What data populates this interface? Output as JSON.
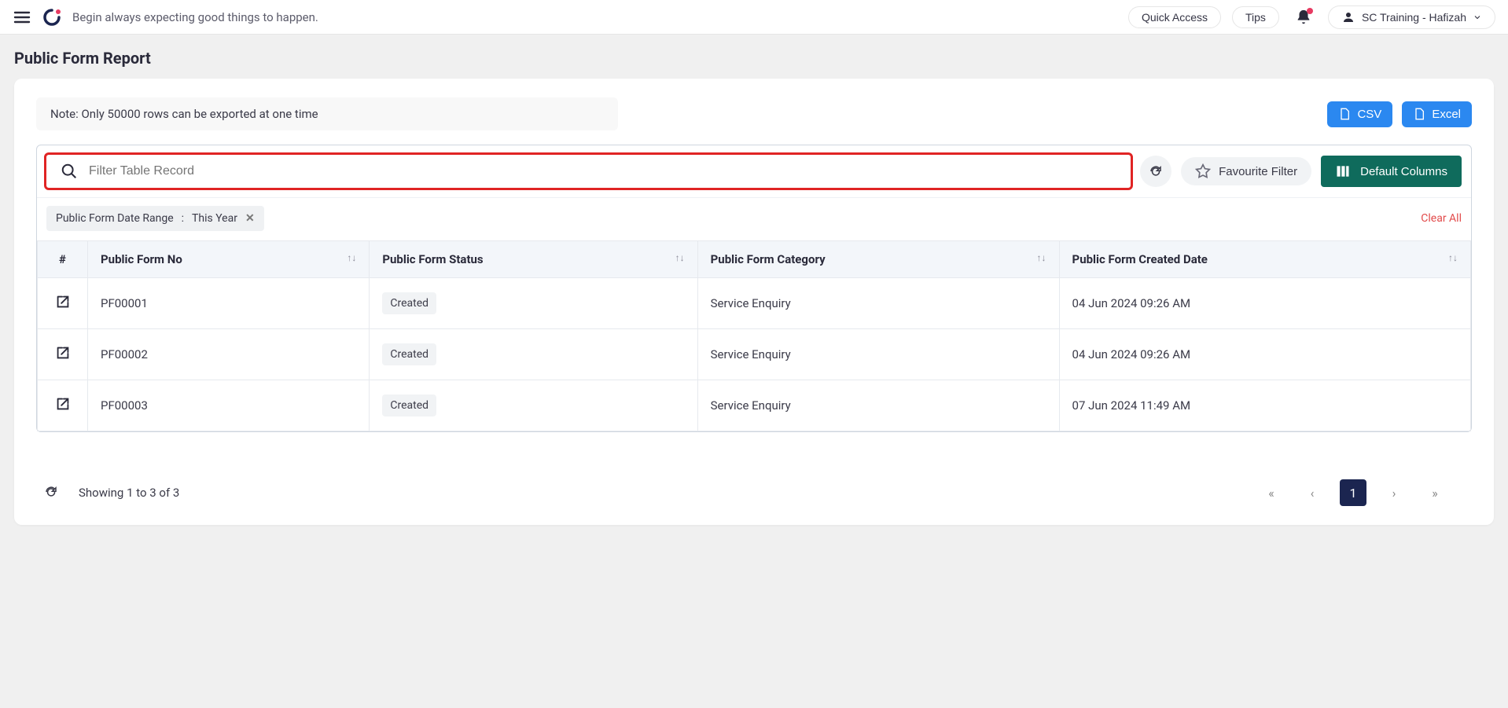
{
  "topbar": {
    "tagline": "Begin always expecting good things to happen.",
    "quick_access": "Quick Access",
    "tips": "Tips",
    "user_label": "SC Training - Hafizah"
  },
  "page": {
    "title": "Public Form Report",
    "note": "Note: Only 50000 rows can be exported at one time",
    "csv_label": "CSV",
    "excel_label": "Excel"
  },
  "filter": {
    "placeholder": "Filter Table Record",
    "favourite_label": "Favourite Filter",
    "default_cols_label": "Default Columns",
    "chip_label": "Public Form Date Range",
    "chip_value": "This Year",
    "clear_all": "Clear All"
  },
  "table": {
    "headers": [
      "#",
      "Public Form No",
      "Public Form Status",
      "Public Form Category",
      "Public Form Created Date"
    ],
    "rows": [
      {
        "form_no": "PF00001",
        "status": "Created",
        "category": "Service Enquiry",
        "created": "04 Jun 2024 09:26 AM"
      },
      {
        "form_no": "PF00002",
        "status": "Created",
        "category": "Service Enquiry",
        "created": "04 Jun 2024 09:26 AM"
      },
      {
        "form_no": "PF00003",
        "status": "Created",
        "category": "Service Enquiry",
        "created": "07 Jun 2024 11:49 AM"
      }
    ]
  },
  "pagination": {
    "showing": "Showing 1 to 3 of 3",
    "current": "1"
  }
}
